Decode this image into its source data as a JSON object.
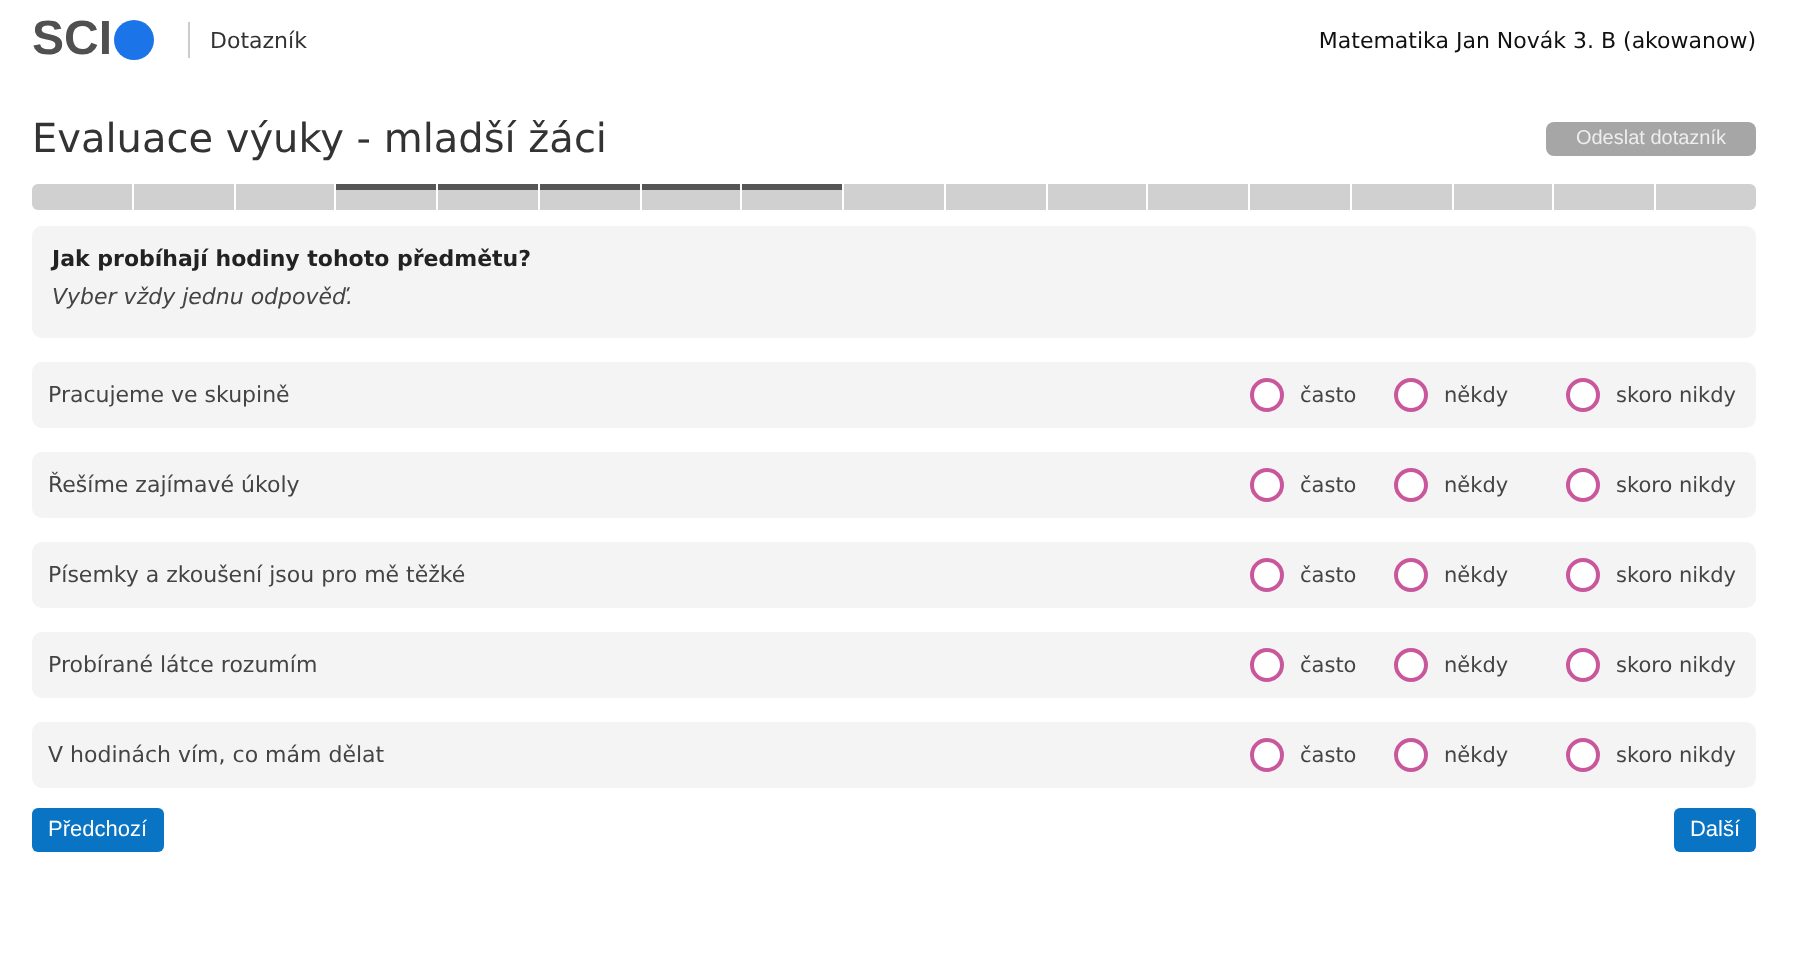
{
  "header": {
    "logo": "SCI",
    "section": "Dotazník",
    "context": "Matematika Jan Novák 3. B (akowanow)"
  },
  "title": "Evaluace výuky - mladší žáci",
  "submit_button": {
    "label": "Odeslat dotazník",
    "disabled": true
  },
  "progress": [
    {
      "selected": false
    },
    {
      "selected": false
    },
    {
      "selected": false
    },
    {
      "selected": true
    },
    {
      "selected": true
    },
    {
      "selected": true
    },
    {
      "selected": true
    },
    {
      "selected": true
    },
    {
      "selected": false
    },
    {
      "selected": false
    },
    {
      "selected": false
    },
    {
      "selected": false
    },
    {
      "selected": false
    },
    {
      "selected": false
    },
    {
      "selected": false
    },
    {
      "selected": false
    },
    {
      "selected": false
    }
  ],
  "question": {
    "text": "Jak probíhají hodiny tohoto předmětu?",
    "hint": "Vyber vždy jednu odpověď."
  },
  "rows": [
    {
      "statement": "Pracujeme ve skupině",
      "options": [
        {
          "label": "často",
          "selected": false
        },
        {
          "label": "někdy",
          "selected": false
        },
        {
          "label": "skoro nikdy",
          "selected": false
        }
      ]
    },
    {
      "statement": "Řešíme zajímavé úkoly",
      "options": [
        {
          "label": "často",
          "selected": false
        },
        {
          "label": "někdy",
          "selected": false
        },
        {
          "label": "skoro nikdy",
          "selected": false
        }
      ]
    },
    {
      "statement": "Písemky a zkoušení jsou pro mě těžké",
      "options": [
        {
          "label": "často",
          "selected": false
        },
        {
          "label": "někdy",
          "selected": false
        },
        {
          "label": "skoro nikdy",
          "selected": false
        }
      ]
    },
    {
      "statement": "Probírané látce rozumím",
      "options": [
        {
          "label": "často",
          "selected": false
        },
        {
          "label": "někdy",
          "selected": false
        },
        {
          "label": "skoro nikdy",
          "selected": false
        }
      ]
    },
    {
      "statement": "V hodinách vím, co mám dělat",
      "options": [
        {
          "label": "často",
          "selected": false
        },
        {
          "label": "někdy",
          "selected": false
        },
        {
          "label": "skoro nikdy",
          "selected": false
        }
      ]
    }
  ],
  "nav": {
    "previous": "Předchozí",
    "next": "Další"
  }
}
